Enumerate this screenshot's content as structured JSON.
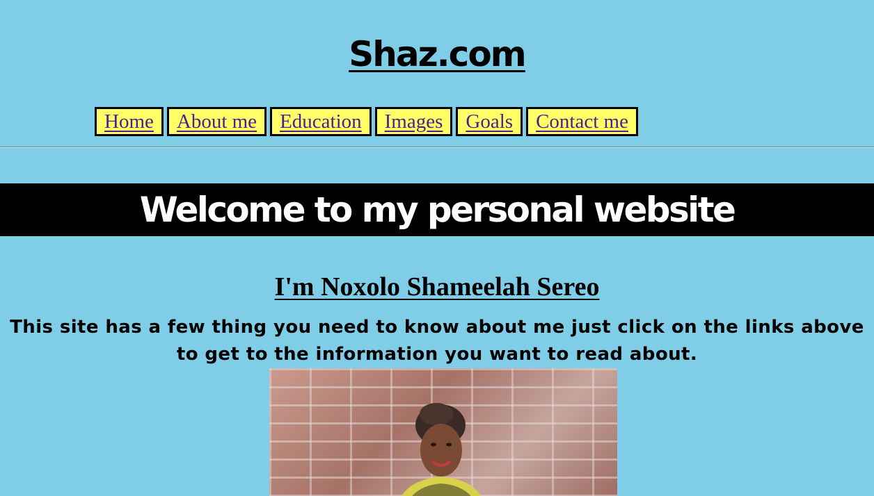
{
  "header": {
    "site_title": "Shaz.com"
  },
  "nav": {
    "items": [
      {
        "label": "Home"
      },
      {
        "label": "About me"
      },
      {
        "label": "Education"
      },
      {
        "label": "Images"
      },
      {
        "label": "Goals"
      },
      {
        "label": "Contact me"
      }
    ]
  },
  "main": {
    "welcome": "Welcome to my personal website",
    "name_heading": "I'm Noxolo Shameelah Sereo",
    "intro": "This site has a few thing you need to know about me just click on the links above to get to the information you want to read about."
  },
  "colors": {
    "page_background": "#7fcde6",
    "nav_background": "#ffff66",
    "link": "#551a8b",
    "band": "#000000"
  }
}
